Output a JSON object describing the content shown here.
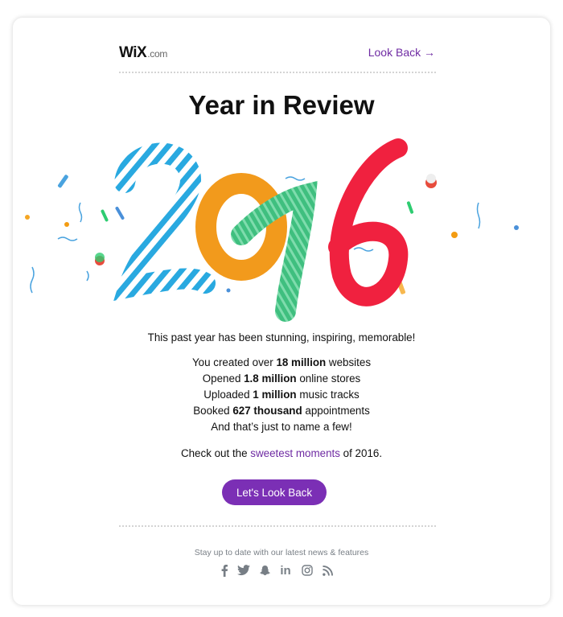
{
  "header": {
    "logo_main": "WiX",
    "logo_suffix": ".com",
    "top_link": "Look Back →"
  },
  "main": {
    "title": "Year in Review",
    "hero_image_label": "2016",
    "intro": "This past year has been stunning, inspiring, memorable!",
    "stats": [
      {
        "prefix": "You created over ",
        "bold": "18 million",
        "suffix": " websites"
      },
      {
        "prefix": "Opened ",
        "bold": "1.8 million",
        "suffix": " online stores"
      },
      {
        "prefix": "Uploaded ",
        "bold": "1 million",
        "suffix": " music tracks"
      },
      {
        "prefix": "Booked ",
        "bold": "627 thousand",
        "suffix": " appointments"
      }
    ],
    "closing": "And that’s just to name a few!",
    "check_prefix": "Check out the ",
    "check_link": "sweetest moments",
    "check_suffix": " of 2016.",
    "cta_label": "Let's Look Back"
  },
  "footer": {
    "text": "Stay up to date with our latest news & features",
    "social": [
      {
        "name": "facebook-icon",
        "glyph": "f"
      },
      {
        "name": "twitter-icon",
        "glyph": ""
      },
      {
        "name": "snapchat-icon",
        "glyph": ""
      },
      {
        "name": "linkedin-icon",
        "glyph": "in"
      },
      {
        "name": "instagram-icon",
        "glyph": ""
      },
      {
        "name": "rss-icon",
        "glyph": ""
      }
    ]
  },
  "colors": {
    "accent": "#7b2fb5",
    "link": "#6f2ba3",
    "digit_2": "#29a9e0",
    "digit_0": "#f29a1c",
    "digit_1": "#3fbf7f",
    "digit_6": "#f0213f"
  }
}
